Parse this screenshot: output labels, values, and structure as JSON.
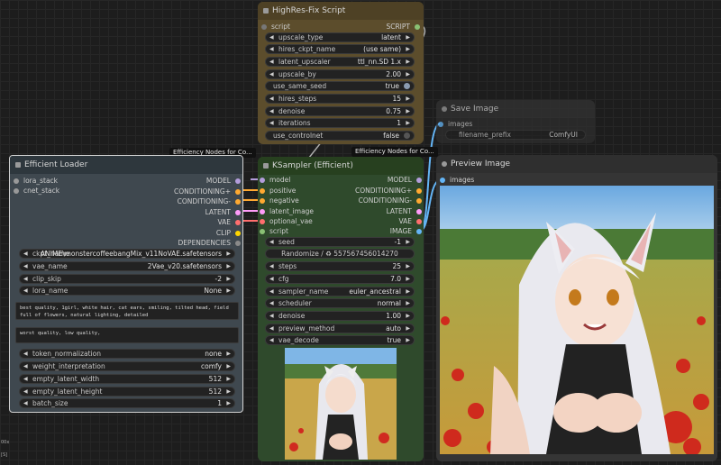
{
  "colors": {
    "canvas": "#1d1d1d",
    "model": "#b39ddb",
    "conditioning": "#ffa931",
    "latent": "#ff9cf9",
    "vae": "#ff6e6e",
    "clip": "#ffd500",
    "script": "#8ac174",
    "image": "#64b5f6",
    "dependencies": "#8a8a8a"
  },
  "highres": {
    "title": "HighRes-Fix Script",
    "in_script": "script",
    "out_script": "SCRIPT",
    "widgets": [
      {
        "label": "upscale_type",
        "value": "latent"
      },
      {
        "label": "hires_ckpt_name",
        "value": "(use same)"
      },
      {
        "label": "latent_upscaler",
        "value": "ttl_nn.SD 1.x"
      },
      {
        "label": "upscale_by",
        "value": "2.00"
      },
      {
        "label": "use_same_seed",
        "value": "true"
      },
      {
        "label": "hires_steps",
        "value": "15"
      },
      {
        "label": "denoise",
        "value": "0.75"
      },
      {
        "label": "iterations",
        "value": "1"
      },
      {
        "label": "use_controlnet",
        "value": "false"
      }
    ],
    "badge": "Efficiency Nodes for Co..."
  },
  "save": {
    "title": "Save Image",
    "in_images": "images",
    "filename_label": "filename_prefix",
    "filename_value": "ComfyUI"
  },
  "loader": {
    "title": "Efficient Loader",
    "badge": "Efficiency Nodes for Co...",
    "inputs": [
      "lora_stack",
      "cnet_stack"
    ],
    "outputs": [
      "MODEL",
      "CONDITIONING+",
      "CONDITIONING-",
      "LATENT",
      "VAE",
      "CLIP",
      "DEPENDENCIES"
    ],
    "widgets": [
      {
        "label": "ckpt_name",
        "value": "ANIME\\monstercoffeebangMix_v11NoVAE.safetensors"
      },
      {
        "label": "vae_name",
        "value": "2Vae_v20.safetensors"
      },
      {
        "label": "clip_skip",
        "value": "-2"
      },
      {
        "label": "lora_name",
        "value": "None"
      }
    ],
    "positive_prompt": "best quality, 1girl, white hair, cat ears, smiling, tilted head, field full of flowers, natural lighting, detailed",
    "negative_prompt": "worst quality, low quality,",
    "widgets2": [
      {
        "label": "token_normalization",
        "value": "none"
      },
      {
        "label": "weight_interpretation",
        "value": "comfy"
      },
      {
        "label": "empty_latent_width",
        "value": "512"
      },
      {
        "label": "empty_latent_height",
        "value": "512"
      },
      {
        "label": "batch_size",
        "value": "1"
      }
    ]
  },
  "ksampler": {
    "title": "KSampler (Efficient)",
    "inputs": [
      "model",
      "positive",
      "negative",
      "latent_image",
      "optional_vae",
      "script"
    ],
    "outputs": [
      "MODEL",
      "CONDITIONING+",
      "CONDITIONING-",
      "LATENT",
      "VAE",
      "IMAGE"
    ],
    "seed_label": "seed",
    "seed_value": "-1",
    "seed_button": "Randomize / ♻ 557567456014270",
    "widgets": [
      {
        "label": "steps",
        "value": "25"
      },
      {
        "label": "cfg",
        "value": "7.0"
      },
      {
        "label": "sampler_name",
        "value": "euler_ancestral"
      },
      {
        "label": "scheduler",
        "value": "normal"
      },
      {
        "label": "denoise",
        "value": "1.00"
      },
      {
        "label": "preview_method",
        "value": "auto"
      },
      {
        "label": "vae_decode",
        "value": "true"
      }
    ]
  },
  "preview": {
    "title": "Preview Image",
    "in_images": "images"
  },
  "misc": {
    "zoom_text": "00x",
    "corner_text": "[S]"
  }
}
